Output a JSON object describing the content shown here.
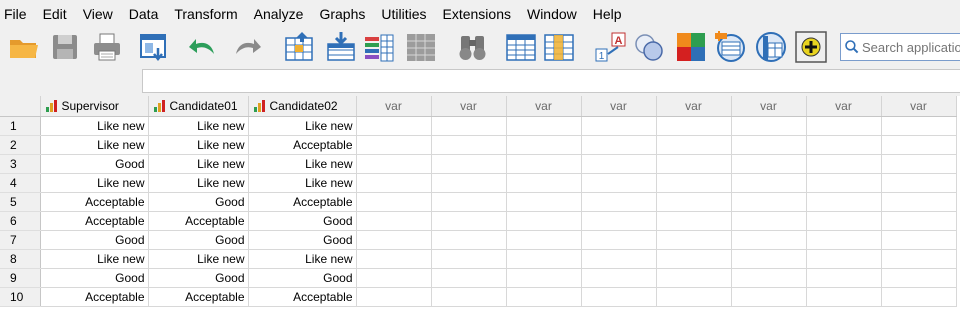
{
  "menu": [
    "File",
    "Edit",
    "View",
    "Data",
    "Transform",
    "Analyze",
    "Graphs",
    "Utilities",
    "Extensions",
    "Window",
    "Help"
  ],
  "toolbar": {
    "icons": [
      "open-folder-icon",
      "save-icon",
      "print-icon",
      "dialog-recall-icon",
      "undo-icon",
      "redo-icon",
      "goto-case-icon",
      "goto-variable-icon",
      "variables-icon",
      "run-descriptives-icon",
      "find-icon",
      "insert-cases-icon",
      "insert-variable-icon",
      "split-file-icon",
      "weight-cases-icon",
      "select-cases-icon",
      "value-labels-icon",
      "use-variable-sets-icon",
      "show-all-variables-icon",
      "spelling-icon"
    ],
    "search_placeholder": "Search application"
  },
  "grid": {
    "columns": [
      "Supervisor",
      "Candidate01",
      "Candidate02"
    ],
    "var_label": "var",
    "var_columns": 8,
    "rows": [
      {
        "n": "1",
        "cells": [
          "Like new",
          "Like new",
          "Like new"
        ]
      },
      {
        "n": "2",
        "cells": [
          "Like new",
          "Like new",
          "Acceptable"
        ]
      },
      {
        "n": "3",
        "cells": [
          "Good",
          "Like new",
          "Like new"
        ]
      },
      {
        "n": "4",
        "cells": [
          "Like new",
          "Like new",
          "Like new"
        ]
      },
      {
        "n": "5",
        "cells": [
          "Acceptable",
          "Good",
          "Acceptable"
        ]
      },
      {
        "n": "6",
        "cells": [
          "Acceptable",
          "Acceptable",
          "Good"
        ]
      },
      {
        "n": "7",
        "cells": [
          "Good",
          "Good",
          "Good"
        ]
      },
      {
        "n": "8",
        "cells": [
          "Like new",
          "Like new",
          "Like new"
        ]
      },
      {
        "n": "9",
        "cells": [
          "Good",
          "Good",
          "Good"
        ]
      },
      {
        "n": "10",
        "cells": [
          "Acceptable",
          "Acceptable",
          "Acceptable"
        ]
      }
    ]
  }
}
